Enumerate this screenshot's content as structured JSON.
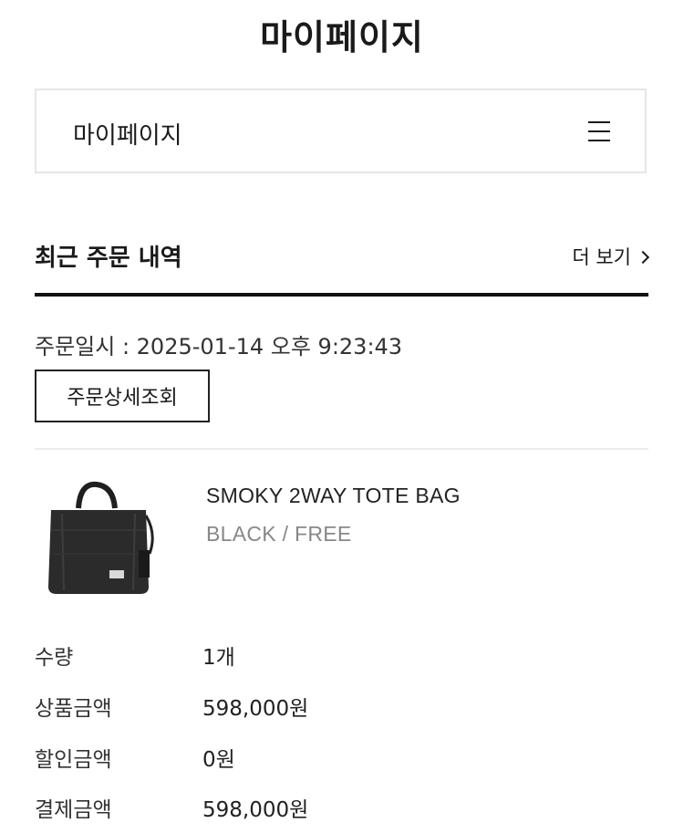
{
  "header": {
    "title": "마이페이지"
  },
  "nav": {
    "label": "마이페이지",
    "menu_icon": "hamburger-menu-icon"
  },
  "recent_orders": {
    "title": "최근 주문 내역",
    "more_label": "더 보기"
  },
  "order": {
    "date_text": "주문일시 : 2025-01-14 오후 9:23:43",
    "detail_button_label": "주문상세조회",
    "product": {
      "name": "SMOKY 2WAY TOTE BAG",
      "option": "BLACK / FREE",
      "image": "black-tote-bag"
    },
    "info": [
      {
        "label": "수량",
        "value": "1개"
      },
      {
        "label": "상품금액",
        "value": "598,000원"
      },
      {
        "label": "할인금액",
        "value": "0원"
      },
      {
        "label": "결제금액",
        "value": "598,000원"
      }
    ]
  },
  "colors": {
    "text": "#1a1a1a",
    "muted": "#888888",
    "rule": "#111111",
    "border_light": "#e6e6e6"
  }
}
